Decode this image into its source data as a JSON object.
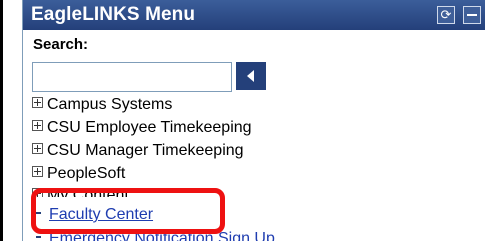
{
  "menu": {
    "title": "EagleLINKS Menu",
    "search_label": "Search:",
    "search_value": "",
    "items": [
      {
        "label": "Campus Systems"
      },
      {
        "label": "CSU Employee Timekeeping"
      },
      {
        "label": "CSU Manager Timekeeping"
      },
      {
        "label": "PeopleSoft"
      },
      {
        "label": "My Content"
      },
      {
        "label": "Faculty Center"
      },
      {
        "label": "Emergency Notification Sign Up"
      }
    ]
  },
  "colors": {
    "title_bar": "#2b4a86",
    "link": "#1f3db0",
    "highlight": "#ee1111"
  },
  "icons": [
    "refresh-icon",
    "minimize-icon",
    "search-arrow-icon",
    "expand-icon",
    "bullet-icon"
  ]
}
